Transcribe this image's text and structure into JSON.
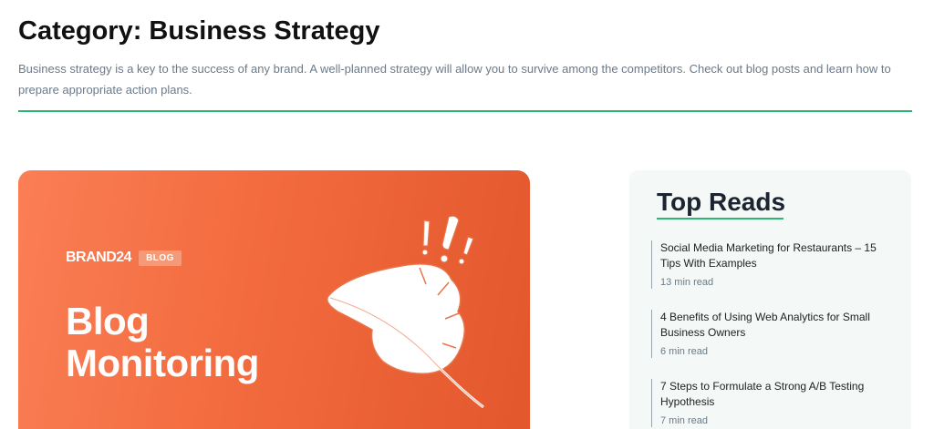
{
  "category": {
    "prefix": "Category: ",
    "name": "Business Strategy",
    "description": "Business strategy is a key to the success of any brand. A well-planned strategy will allow you to survive among the competitors. Check out blog posts and learn how to prepare appropriate action plans."
  },
  "hero": {
    "brand": "BRAND24",
    "tag": "BLOG",
    "title_line1": "Blog",
    "title_line2": "Monitoring"
  },
  "sidebar": {
    "title": "Top Reads",
    "items": [
      {
        "title": "Social Media Marketing for Restaurants – 15 Tips With Examples",
        "meta": "13 min read"
      },
      {
        "title": "4 Benefits of Using Web Analytics for Small Business Owners",
        "meta": "6 min read"
      },
      {
        "title": "7 Steps to Formulate a Strong A/B Testing Hypothesis",
        "meta": "7 min read"
      }
    ]
  },
  "colors": {
    "accent": "#2bb673",
    "hero_orange": "#f26b3e",
    "text_muted": "#6b7a89"
  }
}
